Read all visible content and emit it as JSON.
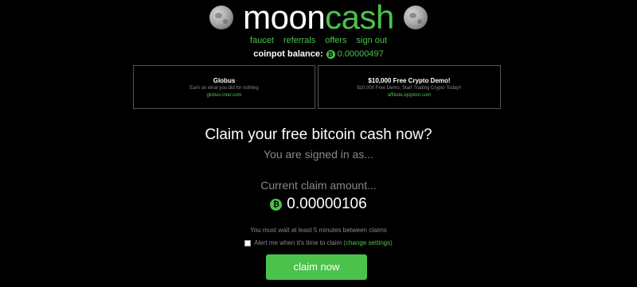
{
  "header": {
    "logo_word1": "moon",
    "logo_word2": "cash"
  },
  "nav": {
    "items": [
      "faucet",
      "referrals",
      "offers",
      "sign out"
    ]
  },
  "balance": {
    "label": "coinpot balance:",
    "coin_symbol": "₿",
    "value": "0.00000497"
  },
  "ads": [
    {
      "title": "Globus",
      "description": "Earn on what you did for nothing",
      "url": "globus-inter.com"
    },
    {
      "title": "$10,000 Free Crypto Demo!",
      "description": "$10,000 Free Demo, Start Trading Crypto Today!!",
      "url": "affiliate.iqoption.com"
    }
  ],
  "main": {
    "headline": "Claim your free bitcoin cash now?",
    "signed_in": "You are signed in as...",
    "claim_label": "Current claim amount...",
    "coin_symbol": "₿",
    "claim_amount": "0.00000106",
    "wait_text": "You must wait at least 5 minutes between claims",
    "alert_text": "Alert me when it's time to claim (",
    "alert_link": "change settings",
    "alert_close": ")",
    "claim_button": "claim now"
  },
  "colors": {
    "accent": "#4bc24b",
    "background": "#000000",
    "muted_text": "#888888"
  }
}
